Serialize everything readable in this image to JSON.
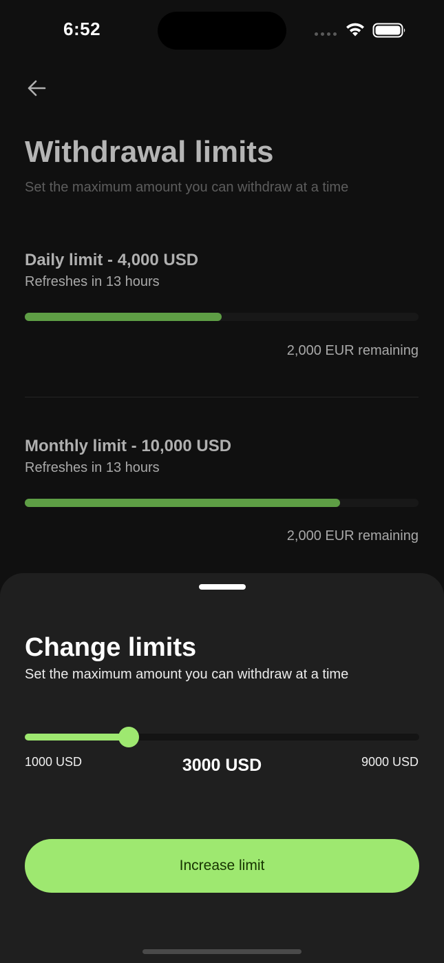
{
  "status_bar": {
    "time": "6:52",
    "icons": [
      "signal-dots-icon",
      "wifi-icon",
      "battery-icon"
    ]
  },
  "header": {
    "back_icon": "arrow-left-icon",
    "title": "Withdrawal limits",
    "subtitle": "Set the maximum amount you can withdraw at a time"
  },
  "limits": [
    {
      "title": "Daily limit - 4,000 USD",
      "refresh": "Refreshes in 13 hours",
      "progress": 0.5,
      "remaining": "2,000 EUR remaining"
    },
    {
      "title": "Monthly limit - 10,000 USD",
      "refresh": "Refreshes in 13 hours",
      "progress": 0.8,
      "remaining": "2,000 EUR remaining"
    }
  ],
  "sheet": {
    "title": "Change limits",
    "subtitle": "Set the maximum amount you can withdraw at a time",
    "slider": {
      "min_label": "1000 USD",
      "max_label": "9000 USD",
      "value_label": "3000 USD",
      "min": 1000,
      "max": 9000,
      "value": 3000
    },
    "button_label": "Increase limit"
  },
  "colors": {
    "accent": "#9ee870",
    "accent_dim": "#5e9e45",
    "sheet_bg": "#1f1f1f",
    "screen_bg": "#101010"
  }
}
